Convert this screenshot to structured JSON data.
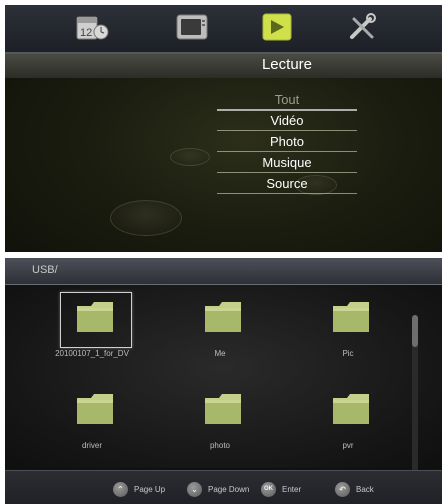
{
  "top_menu": {
    "icons": [
      {
        "name": "calendar-icon",
        "label": ""
      },
      {
        "name": "tv-icon",
        "label": ""
      },
      {
        "name": "play-icon",
        "label": ""
      },
      {
        "name": "tools-icon",
        "label": ""
      }
    ],
    "active_icon_index": 2,
    "title": "Lecture",
    "items": [
      {
        "label": "Tout"
      },
      {
        "label": "Vidéo"
      },
      {
        "label": "Photo"
      },
      {
        "label": "Musique"
      },
      {
        "label": "Source"
      }
    ],
    "colors": {
      "active_icon": "#cfe04a"
    }
  },
  "browser": {
    "path": "USB/",
    "files": [
      {
        "label": "20100107_1_for_DV",
        "icon": "folder-icon",
        "selected": true
      },
      {
        "label": "Me",
        "icon": "folder-icon",
        "selected": false
      },
      {
        "label": "Pic",
        "icon": "folder-icon",
        "selected": false
      },
      {
        "label": "driver",
        "icon": "folder-icon",
        "selected": false
      },
      {
        "label": "photo",
        "icon": "folder-icon",
        "selected": false
      },
      {
        "label": "pvr",
        "icon": "folder-icon",
        "selected": false
      }
    ],
    "scroll_fraction": 0.15,
    "help": [
      {
        "icon": "page-up-icon",
        "label": "Page Up"
      },
      {
        "icon": "page-down-icon",
        "label": "Page Down"
      },
      {
        "icon": "ok-icon",
        "key": "OK",
        "label": "Enter"
      },
      {
        "icon": "back-icon",
        "label": "Back"
      }
    ],
    "colors": {
      "folder": "#a7b86a"
    }
  }
}
